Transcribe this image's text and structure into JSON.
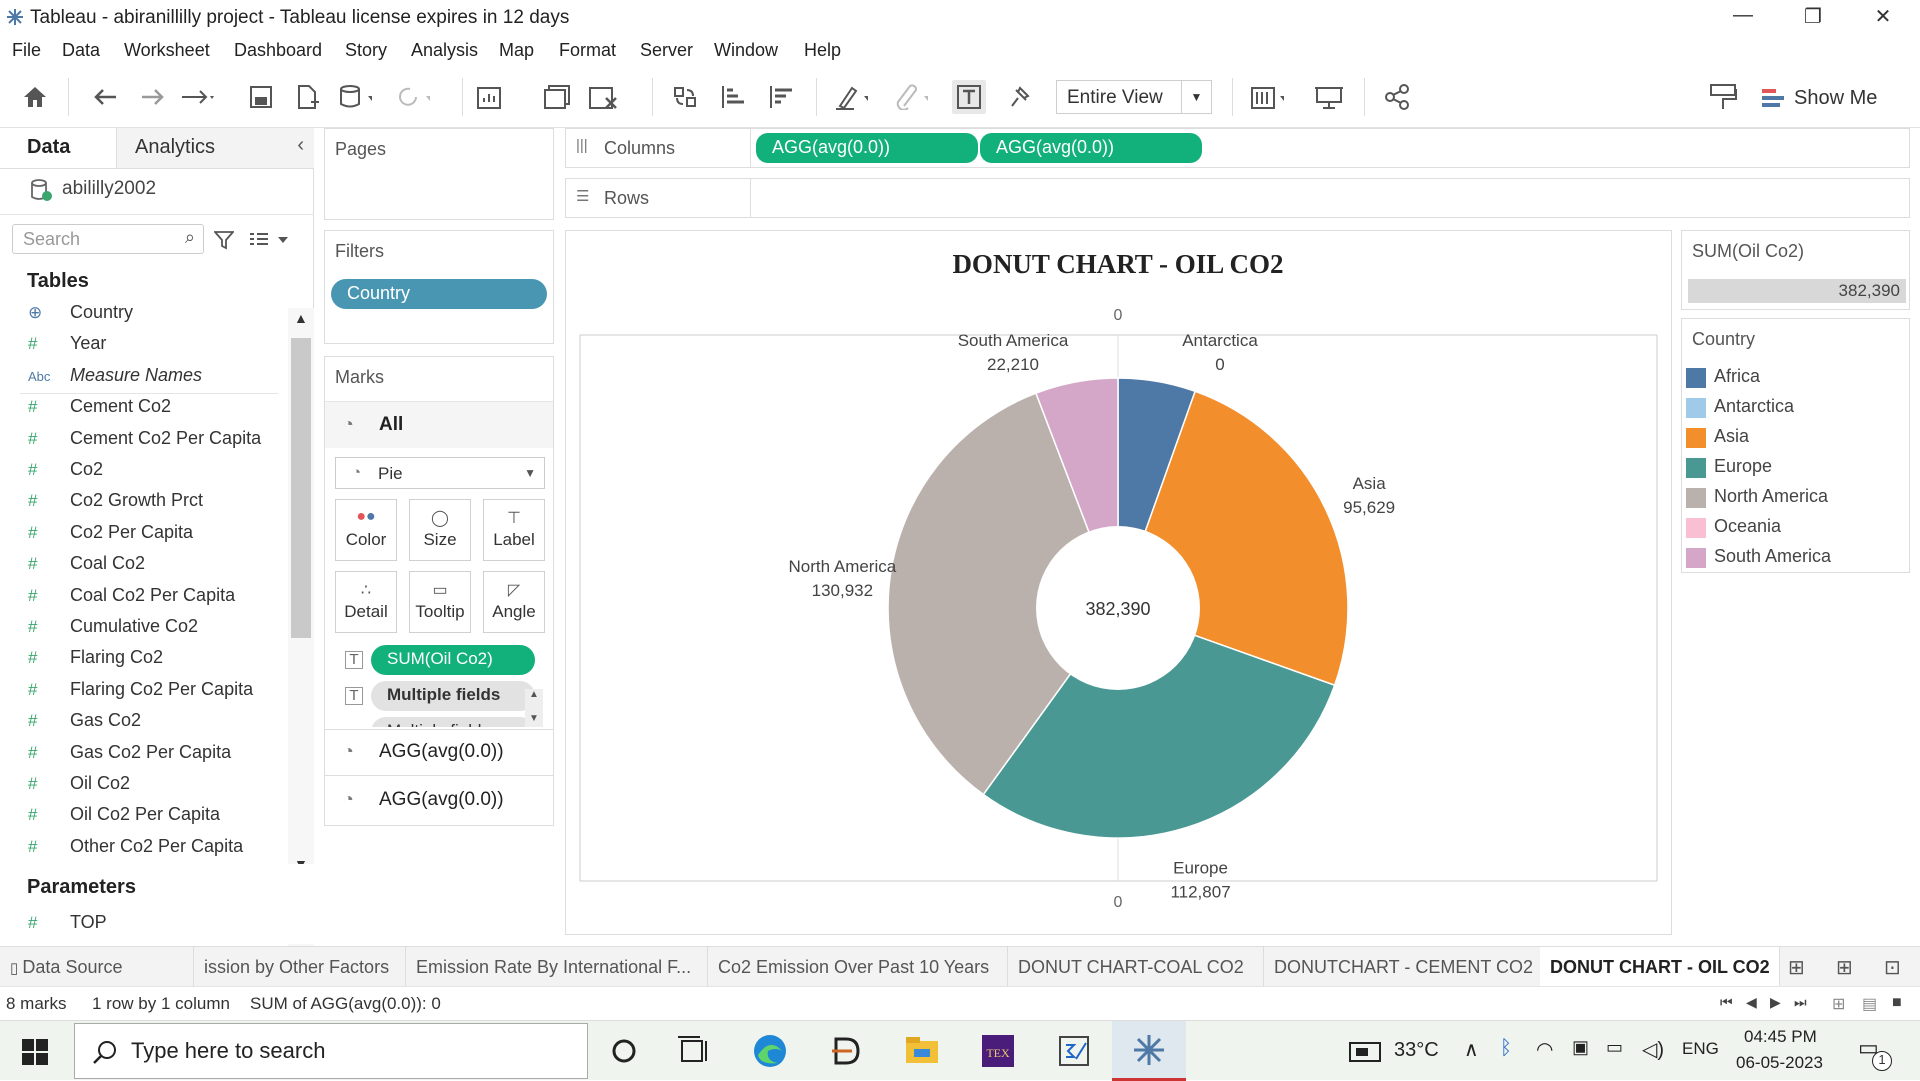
{
  "window": {
    "title": "Tableau - abiranillilly project - Tableau license expires in 12 days",
    "minimize": "—",
    "restore": "❐",
    "close": "✕"
  },
  "menu": [
    "File",
    "Data",
    "Worksheet",
    "Dashboard",
    "Story",
    "Analysis",
    "Map",
    "Format",
    "Server",
    "Window",
    "Help"
  ],
  "toolbar": {
    "fit_value": "Entire View",
    "show_me": "Show Me"
  },
  "left_pane": {
    "tab_data": "Data",
    "tab_analytics": "Analytics",
    "datasource": "abililly2002",
    "search_placeholder": "Search",
    "tables_header": "Tables",
    "parameters_header": "Parameters",
    "fields": [
      {
        "icon": "globe",
        "type": "⊕",
        "name": "Country",
        "italic": false
      },
      {
        "icon": "hash",
        "type": "#",
        "name": "Year",
        "italic": false
      },
      {
        "icon": "abc",
        "type": "Abc",
        "name": "Measure Names",
        "italic": true
      },
      {
        "icon": "hash",
        "type": "#",
        "name": "Cement Co2",
        "italic": false
      },
      {
        "icon": "hash",
        "type": "#",
        "name": "Cement Co2 Per Capita",
        "italic": false
      },
      {
        "icon": "hash",
        "type": "#",
        "name": "Co2",
        "italic": false
      },
      {
        "icon": "hash",
        "type": "#",
        "name": "Co2 Growth Prct",
        "italic": false
      },
      {
        "icon": "hash",
        "type": "#",
        "name": "Co2 Per Capita",
        "italic": false
      },
      {
        "icon": "hash",
        "type": "#",
        "name": "Coal Co2",
        "italic": false
      },
      {
        "icon": "hash",
        "type": "#",
        "name": "Coal Co2 Per Capita",
        "italic": false
      },
      {
        "icon": "hash",
        "type": "#",
        "name": "Cumulative Co2",
        "italic": false
      },
      {
        "icon": "hash",
        "type": "#",
        "name": "Flaring Co2",
        "italic": false
      },
      {
        "icon": "hash",
        "type": "#",
        "name": "Flaring Co2 Per Capita",
        "italic": false
      },
      {
        "icon": "hash",
        "type": "#",
        "name": "Gas Co2",
        "italic": false
      },
      {
        "icon": "hash",
        "type": "#",
        "name": "Gas Co2 Per Capita",
        "italic": false
      },
      {
        "icon": "hash",
        "type": "#",
        "name": "Oil Co2",
        "italic": false
      },
      {
        "icon": "hash",
        "type": "#",
        "name": "Oil Co2 Per Capita",
        "italic": false
      },
      {
        "icon": "hash",
        "type": "#",
        "name": "Other Co2 Per Capita",
        "italic": false
      }
    ],
    "parameters": [
      {
        "type": "#",
        "name": "TOP"
      }
    ]
  },
  "cards": {
    "pages": "Pages",
    "filters": "Filters",
    "filter_pill": "Country",
    "marks": "Marks",
    "marks_all": "All",
    "mark_type": "Pie",
    "mark_buttons": [
      "Color",
      "Size",
      "Label",
      "Detail",
      "Tooltip",
      "Angle"
    ],
    "mark_fields": [
      "SUM(Oil Co2)",
      "Multiple fields",
      "Multiple fields"
    ],
    "mark_layers": [
      "AGG(avg(0.0))",
      "AGG(avg(0.0))"
    ]
  },
  "shelves": {
    "columns_label": "Columns",
    "rows_label": "Rows",
    "columns_pills": [
      "AGG(avg(0.0))",
      "AGG(avg(0.0))"
    ]
  },
  "chart_data": {
    "type": "pie",
    "title": "DONUT CHART - OIL CO2",
    "center_label": "382,390",
    "axis_top_label": "0",
    "axis_bottom_label": "0",
    "slices": [
      {
        "name": "Africa",
        "value": 20812,
        "color": "#4e79a7",
        "label": false
      },
      {
        "name": "Antarctica",
        "value": 0,
        "color": "#a0cbe8",
        "label": true
      },
      {
        "name": "Asia",
        "value": 95629,
        "color": "#f28e2b",
        "label": true
      },
      {
        "name": "Europe",
        "value": 112807,
        "color": "#499894",
        "label": true
      },
      {
        "name": "North America",
        "value": 130932,
        "color": "#bab0ac",
        "label": true
      },
      {
        "name": "Oceania",
        "value": 0,
        "color": "#fabfd2",
        "label": false
      },
      {
        "name": "South America",
        "value": 22210,
        "color": "#d4a6c8",
        "label": true
      }
    ],
    "label_values": {
      "Antarctica": "0",
      "Asia": "95,629",
      "Europe": "112,807",
      "North America": "130,932",
      "South America": "22,210"
    }
  },
  "legend": {
    "size_title": "SUM(Oil Co2)",
    "size_value": "382,390",
    "color_title": "Country",
    "items": [
      "Africa",
      "Antarctica",
      "Asia",
      "Europe",
      "North America",
      "Oceania",
      "South America"
    ]
  },
  "sheet_tabs": [
    "Data Source",
    "ission by Other Factors",
    "Emission Rate By International F...",
    "Co2 Emission Over Past 10 Years",
    "DONUT CHART-COAL CO2",
    "DONUTCHART - CEMENT CO2",
    "DONUT CHART - OIL CO2"
  ],
  "status": {
    "marks": "8 marks",
    "rows": "1 row by 1 column",
    "sum": "SUM of AGG(avg(0.0)): 0"
  },
  "taskbar": {
    "search_placeholder": "Type here to search",
    "temperature": "33°C",
    "language": "ENG",
    "time": "04:45 PM",
    "date": "06-05-2023",
    "notifications": "1"
  }
}
